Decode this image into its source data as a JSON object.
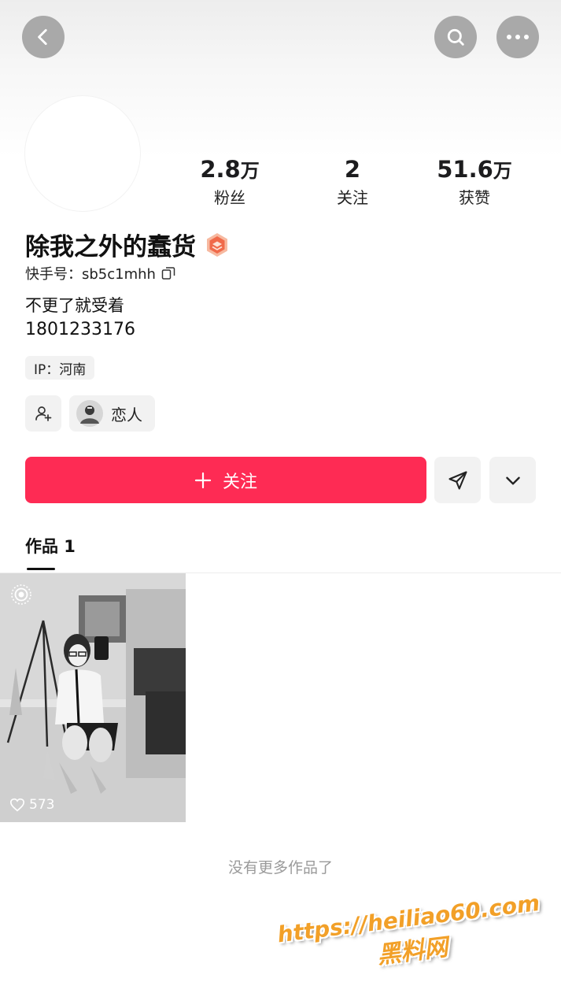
{
  "header": {
    "back_icon": "chevron-left-icon",
    "search_icon": "search-icon",
    "more_icon": "more-horizontal-icon"
  },
  "profile": {
    "stats": [
      {
        "value": "2.8",
        "unit": "万",
        "label": "粉丝"
      },
      {
        "value": "2",
        "unit": "",
        "label": "关注"
      },
      {
        "value": "51.6",
        "unit": "万",
        "label": "获赞"
      }
    ],
    "name": "除我之外的蠢货",
    "id_label": "快手号：sb5c1mhh",
    "bio_line1": "不更了就受着",
    "bio_line2": "1801233176",
    "ip_tag": "IP：河南",
    "relation_label": "恋人"
  },
  "actions": {
    "follow_label": "关注",
    "accent_color": "#fe2b54"
  },
  "tabs": {
    "works_label": "作品 1"
  },
  "works": [
    {
      "likes": "573"
    }
  ],
  "footer": {
    "empty_note": "没有更多作品了"
  },
  "watermark": {
    "line1": "https://heiliao60.com",
    "line2": "黑料网"
  }
}
